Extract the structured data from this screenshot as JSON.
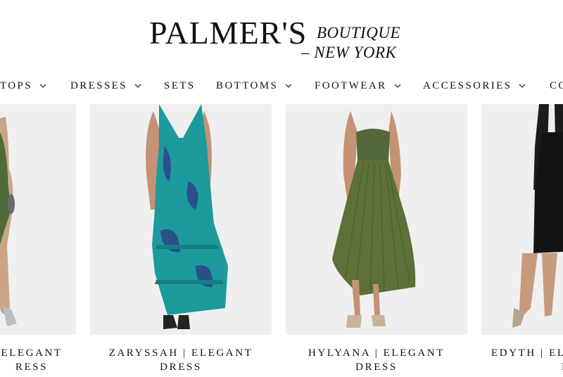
{
  "brand": {
    "name": "PALMER'S",
    "tagline_line1": "BOUTIQUE",
    "tagline_line2": "– NEW YORK"
  },
  "nav": {
    "items": [
      {
        "label": "TOPS",
        "has_dropdown": true
      },
      {
        "label": "DRESSES",
        "has_dropdown": true
      },
      {
        "label": "SETS",
        "has_dropdown": false
      },
      {
        "label": "BOTTOMS",
        "has_dropdown": true
      },
      {
        "label": "FOOTWEAR",
        "has_dropdown": true
      },
      {
        "label": "ACCESSORIES",
        "has_dropdown": true
      },
      {
        "label": "CO",
        "has_dropdown": false
      }
    ]
  },
  "products": [
    {
      "name": "ELEGANT DRESS",
      "name_line1": "ELEGANT",
      "name_line2": "RESS",
      "image": "model in green slit gown"
    },
    {
      "name": "ZARYSSAH | ELEGANT DRESS",
      "name_line1": "ZARYSSAH | ELEGANT",
      "name_line2": "DRESS",
      "image": "model in teal floral ruffled maxi dress"
    },
    {
      "name": "HYLYANA | ELEGANT DRESS",
      "name_line1": "HYLYANA | ELEGANT",
      "name_line2": "DRESS",
      "image": "model in olive green pleated midi dress"
    },
    {
      "name": "EDYTH | ELEGANT DRESS",
      "name_line1": "EDYTH | EL",
      "name_line2": "DRE",
      "image": "model in black dress with lace sleeves"
    }
  ],
  "colors": {
    "text": "#111111",
    "card_bg": "#efefef",
    "teal_dress": "#1c9a9c",
    "olive_dress": "#5c7038",
    "black_dress": "#141414"
  }
}
